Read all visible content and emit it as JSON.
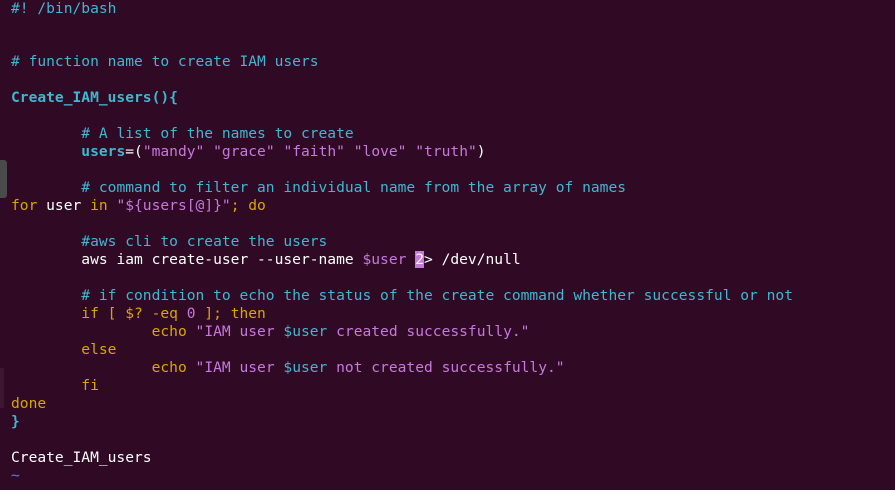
{
  "editor": {
    "lines": {
      "shebang": "#! /bin/bash",
      "c1": "# function name to create IAM users",
      "fn_decl": "Create_IAM_users(){",
      "c2": "# A list of the names to create",
      "users_var": "users",
      "users_eq": "=(",
      "u1": "\"mandy\"",
      "u2": "\"grace\"",
      "u3": "\"faith\"",
      "u4": "\"love\"",
      "u5": "\"truth\"",
      "users_close": ")",
      "c3": "# command to filter an individual name from the array of names",
      "for_kw": "for",
      "for_user": " user ",
      "in_kw": "in",
      "for_str": "\"${users[@]}\"",
      "for_semi": "; ",
      "do_kw": "do",
      "c4": "#aws cli to create the users",
      "aws_cmd": "aws iam create-user --user-name ",
      "aws_var": "$user",
      "aws_space": " ",
      "cursor_char": "2",
      "aws_redirect": "> /dev/null",
      "c5": "# if condition to echo the status of the create command whether successful or not",
      "if_kw": "if",
      "if_test": " [ $? -eq ",
      "if_zero": "0",
      "if_end": " ]; ",
      "then_kw": "then",
      "echo1_kw": "echo",
      "echo1_pre": " \"IAM user ",
      "echo1_var": "$user",
      "echo1_post": " created successfully.\"",
      "else_kw": "else",
      "echo2_kw": "echo",
      "echo2_pre": " \"IAM user ",
      "echo2_var": "$user",
      "echo2_post": " not created successfully.\"",
      "fi_kw": "fi",
      "done_kw": "done",
      "close_brace": "}",
      "call": "Create_IAM_users",
      "tilde": "~"
    }
  }
}
